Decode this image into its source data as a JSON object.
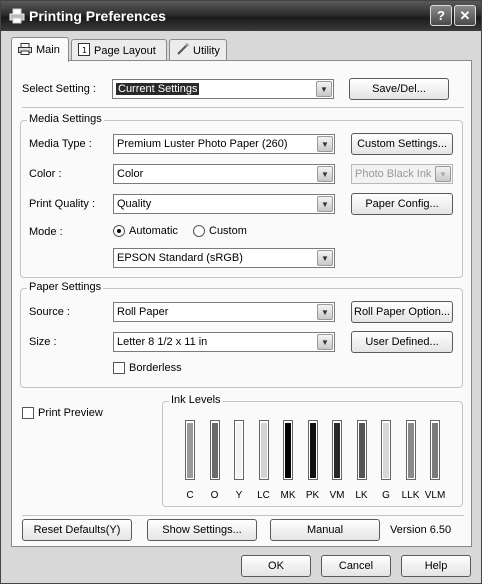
{
  "window": {
    "title": "Printing Preferences",
    "help_glyph": "?",
    "close_glyph": "✕"
  },
  "tabs": [
    {
      "label": "Main",
      "icon": "printer-icon"
    },
    {
      "label": "Page Layout",
      "icon": "page-icon"
    },
    {
      "label": "Utility",
      "icon": "wrench-icon"
    }
  ],
  "select_setting": {
    "label": "Select Setting :",
    "value": "Current Settings",
    "button": "Save/Del..."
  },
  "media_settings": {
    "title": "Media Settings",
    "media_type_label": "Media Type :",
    "media_type_value": "Premium Luster Photo Paper (260)",
    "custom_settings_button": "Custom Settings...",
    "color_label": "Color :",
    "color_value": "Color",
    "ink_select_value": "Photo Black Ink",
    "print_quality_label": "Print Quality :",
    "print_quality_value": "Quality",
    "paper_config_button": "Paper Config...",
    "mode_label": "Mode :",
    "mode_automatic": "Automatic",
    "mode_custom": "Custom",
    "mode_value": "EPSON Standard (sRGB)"
  },
  "paper_settings": {
    "title": "Paper Settings",
    "source_label": "Source :",
    "source_value": "Roll Paper",
    "roll_paper_option_button": "Roll Paper Option...",
    "size_label": "Size :",
    "size_value": "Letter 8 1/2 x 11 in",
    "user_defined_button": "User Defined...",
    "borderless_label": "Borderless"
  },
  "print_preview_label": "Print Preview",
  "ink_levels": {
    "title": "Ink Levels",
    "inks": [
      {
        "name": "C",
        "level": 0.95,
        "color": "#9a9a9a"
      },
      {
        "name": "O",
        "level": 0.95,
        "color": "#6a6a6a"
      },
      {
        "name": "Y",
        "level": 0.95,
        "color": "#f4f4f4"
      },
      {
        "name": "LC",
        "level": 0.95,
        "color": "#d4d4d4"
      },
      {
        "name": "MK",
        "level": 0.95,
        "color": "#000000"
      },
      {
        "name": "PK",
        "level": 0.95,
        "color": "#111111"
      },
      {
        "name": "VM",
        "level": 0.95,
        "color": "#2a2a2a"
      },
      {
        "name": "LK",
        "level": 0.95,
        "color": "#555555"
      },
      {
        "name": "G",
        "level": 0.95,
        "color": "#d8d8d8"
      },
      {
        "name": "LLK",
        "level": 0.95,
        "color": "#8a8a8a"
      },
      {
        "name": "VLM",
        "level": 0.95,
        "color": "#7a7a7a"
      }
    ]
  },
  "bottom_bar": {
    "reset_defaults": "Reset Defaults(Y)",
    "show_settings": "Show Settings...",
    "manual": "Manual",
    "version": "Version 6.50"
  },
  "dialog_buttons": {
    "ok": "OK",
    "cancel": "Cancel",
    "help": "Help"
  }
}
